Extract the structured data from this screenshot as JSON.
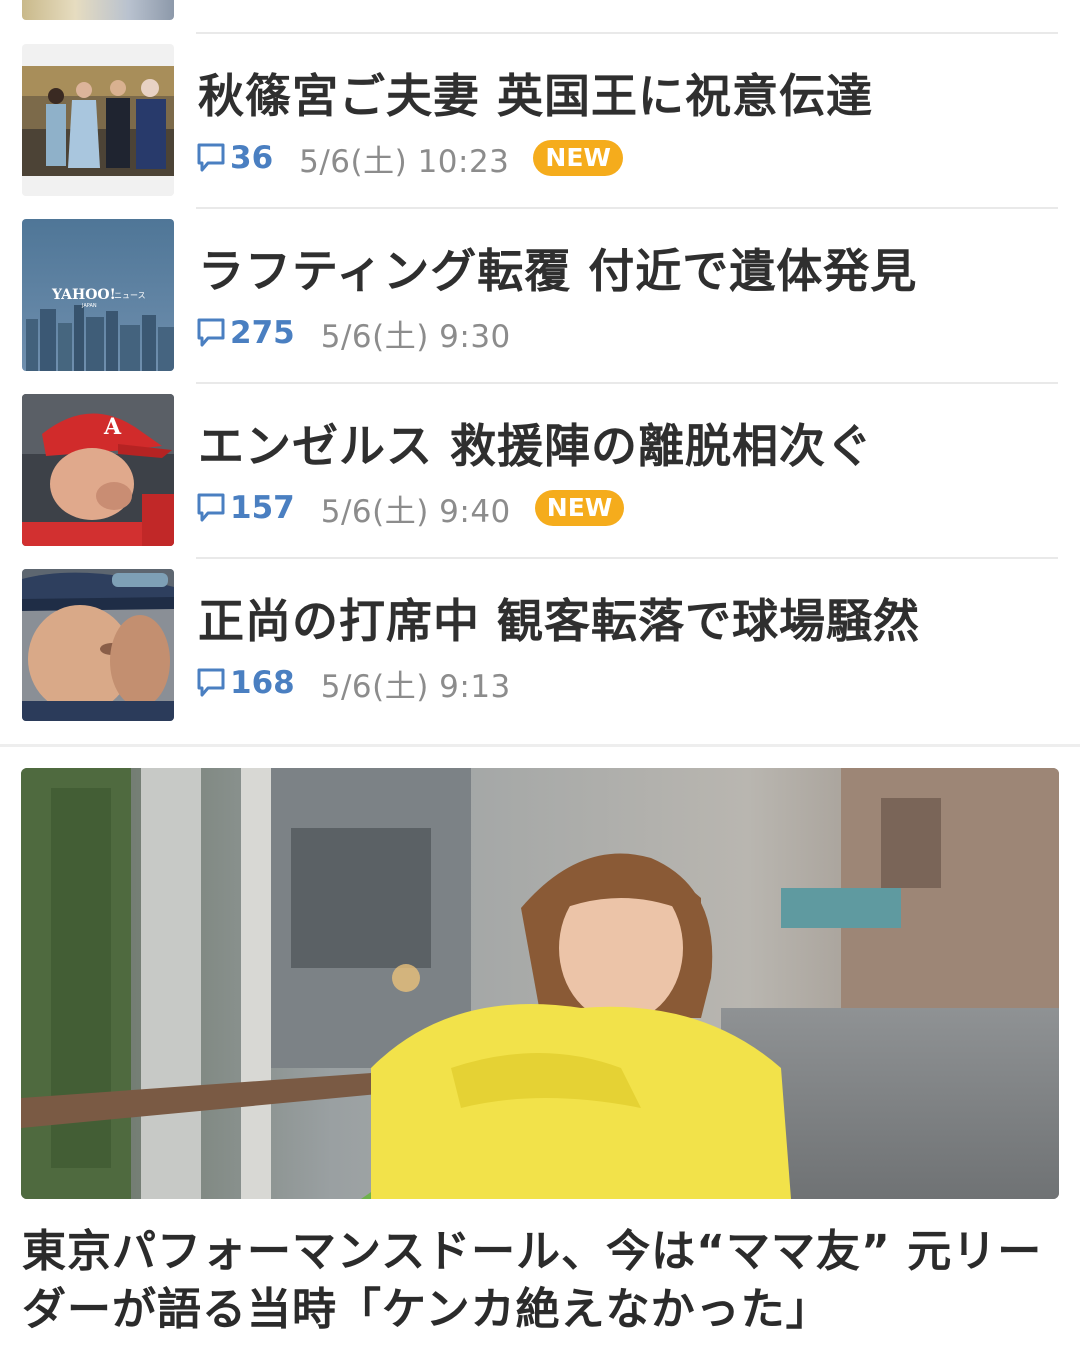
{
  "news": [
    {
      "title": "秋篠宮ご夫妻 英国王に祝意伝達",
      "comments": "36",
      "date": "5/6(土) 10:23",
      "badge": "NEW",
      "thumb_icon": "royal-couple-photo"
    },
    {
      "title": "ラフティング転覆 付近で遺体発見",
      "comments": "275",
      "date": "5/6(土) 9:30",
      "badge": "",
      "thumb_icon": "yahoo-news-placeholder",
      "thumb_logo": "YAHOO!",
      "thumb_logo_sub": "JAPAN",
      "thumb_logo_label": "ニュース"
    },
    {
      "title": "エンゼルス 救援陣の離脱相次ぐ",
      "comments": "157",
      "date": "5/6(土) 9:40",
      "badge": "NEW",
      "thumb_icon": "baseball-player-photo"
    },
    {
      "title": "正尚の打席中 観客転落で球場騒然",
      "comments": "168",
      "date": "5/6(土) 9:13",
      "badge": "",
      "thumb_icon": "batter-photo"
    }
  ],
  "feature": {
    "headline": "東京パフォーマンスドール、今は“ママ友” 元リーダーが語る当時「ケンカ絶えなかった」",
    "photo_icon": "woman-yellow-sweater-photo"
  },
  "colors": {
    "comment_blue": "#4a7fc1",
    "badge_orange": "#f5ac1c",
    "date_gray": "#8c8c8c",
    "divider": "#e9e9e9"
  }
}
